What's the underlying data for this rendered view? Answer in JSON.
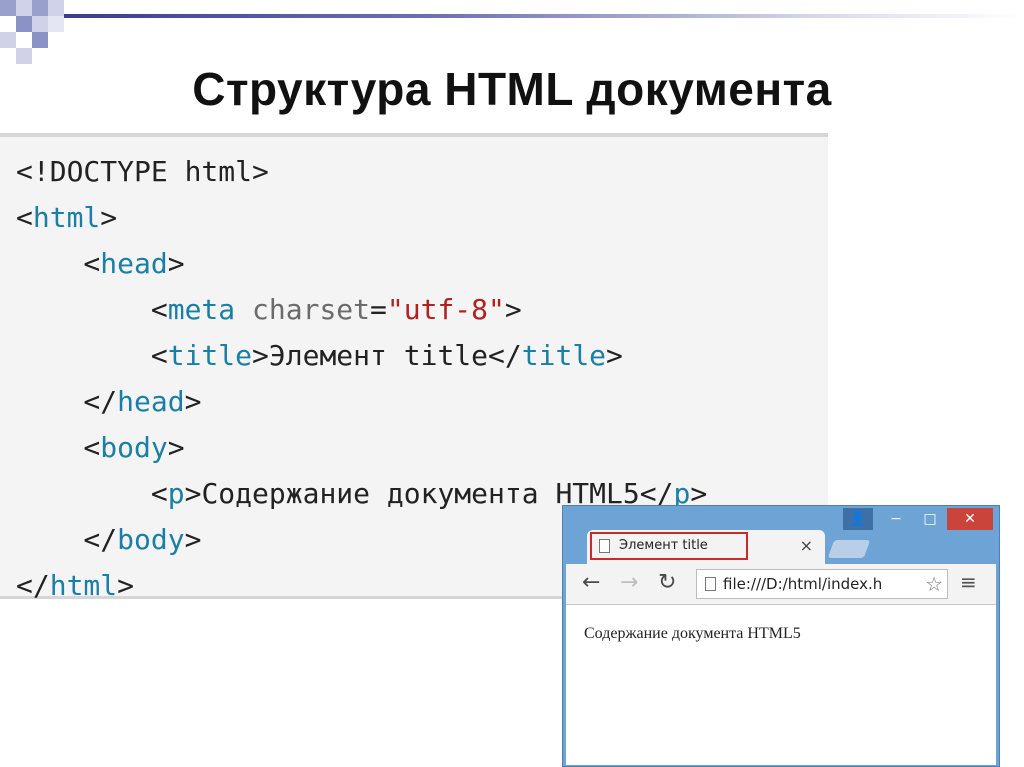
{
  "title": "Структура HTML документа",
  "code": {
    "lines": [
      [
        {
          "c": "punc",
          "t": "<!DOCTYPE html>"
        }
      ],
      [
        {
          "c": "punc",
          "t": "<"
        },
        {
          "c": "tag",
          "t": "html"
        },
        {
          "c": "punc",
          "t": ">"
        }
      ],
      [
        {
          "c": "punc",
          "t": "    <"
        },
        {
          "c": "tag",
          "t": "head"
        },
        {
          "c": "punc",
          "t": ">"
        }
      ],
      [
        {
          "c": "punc",
          "t": "        <"
        },
        {
          "c": "tag",
          "t": "meta"
        },
        {
          "c": "attr",
          "t": " charset"
        },
        {
          "c": "punc",
          "t": "="
        },
        {
          "c": "str",
          "t": "\"utf-8\""
        },
        {
          "c": "punc",
          "t": ">"
        }
      ],
      [
        {
          "c": "punc",
          "t": "        <"
        },
        {
          "c": "tag",
          "t": "title"
        },
        {
          "c": "punc",
          "t": ">"
        },
        {
          "c": "txt",
          "t": "Элемент title"
        },
        {
          "c": "punc",
          "t": "</"
        },
        {
          "c": "tag",
          "t": "title"
        },
        {
          "c": "punc",
          "t": ">"
        }
      ],
      [
        {
          "c": "punc",
          "t": "    </"
        },
        {
          "c": "tag",
          "t": "head"
        },
        {
          "c": "punc",
          "t": ">"
        }
      ],
      [
        {
          "c": "punc",
          "t": "    <"
        },
        {
          "c": "tag",
          "t": "body"
        },
        {
          "c": "punc",
          "t": ">"
        }
      ],
      [
        {
          "c": "punc",
          "t": "        <"
        },
        {
          "c": "tag",
          "t": "p"
        },
        {
          "c": "punc",
          "t": ">"
        },
        {
          "c": "txt",
          "t": "Содержание документа HTML5"
        },
        {
          "c": "punc",
          "t": "</"
        },
        {
          "c": "tag",
          "t": "p"
        },
        {
          "c": "punc",
          "t": ">"
        }
      ],
      [
        {
          "c": "punc",
          "t": "    </"
        },
        {
          "c": "tag",
          "t": "body"
        },
        {
          "c": "punc",
          "t": ">"
        }
      ],
      [
        {
          "c": "punc",
          "t": "</"
        },
        {
          "c": "tag",
          "t": "html"
        },
        {
          "c": "punc",
          "t": ">"
        }
      ]
    ]
  },
  "browser": {
    "tab_title": "Элемент title",
    "tab_close": "×",
    "address": "file:///D:/html/index.h",
    "page_text": "Содержание документа HTML5",
    "icons": {
      "back": "←",
      "forward": "→",
      "reload": "↻",
      "star": "☆",
      "menu": "≡",
      "user": "👤",
      "minimize": "−",
      "maximize": "□",
      "close": "✕"
    }
  },
  "colors": {
    "tag": "#1a7fa6",
    "string": "#b4201f",
    "attribute": "#6b6b6b",
    "tab_highlight": "#cc2a2a",
    "window_frame": "#6ea3d6"
  }
}
